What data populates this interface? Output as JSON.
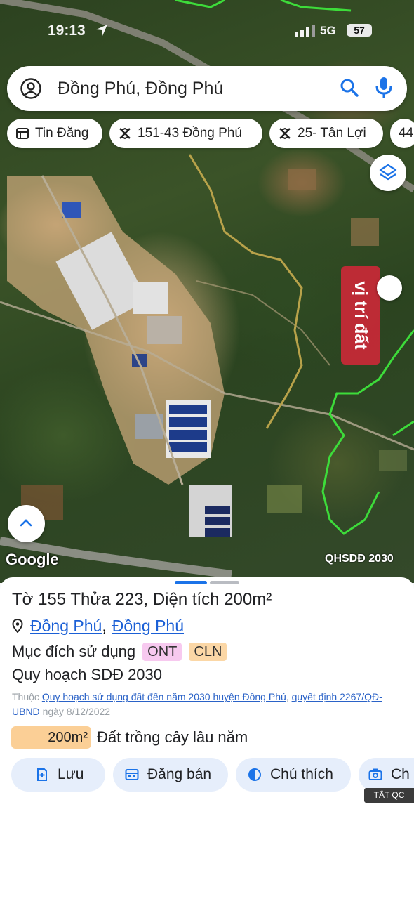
{
  "status_bar": {
    "time": "19:13",
    "network": "5G",
    "battery": "57"
  },
  "search": {
    "query": "Đồng Phú, Đồng Phú"
  },
  "chips": [
    {
      "label": "Tin Đăng",
      "icon": "list-icon"
    },
    {
      "label": "151-43 Đồng Phú",
      "icon": "map-off-icon"
    },
    {
      "label": "25-  Tân Lợi",
      "icon": "map-off-icon"
    },
    {
      "label": "44",
      "icon": "map-off-icon"
    }
  ],
  "map": {
    "pin_label": "vị trí đất",
    "attribution": "Google",
    "layer_label": "QHSDĐ 2030"
  },
  "parcel": {
    "title": "Tờ 155 Thửa 223, Diện tích 200m²",
    "location_part1": "Đồng Phú",
    "location_separator": ",",
    "location_part2": "Đồng Phú",
    "purpose_label": "Mục đích sử dụng",
    "purpose_codes": [
      "ONT",
      "CLN"
    ],
    "plan_title": "Quy hoạch SDĐ 2030",
    "plan_note_prefix": "Thuộc",
    "plan_note_link1": "Quy hoạch sử dụng đất đến năm 2030 huyện Đồng Phú",
    "plan_note_link2": "quyết định 2267/QĐ-UBND",
    "plan_note_suffix": "ngày 8/12/2022",
    "area_value": "200m²",
    "area_desc": "Đất trồng cây lâu năm"
  },
  "actions": [
    {
      "label": "Lưu",
      "icon": "save-icon"
    },
    {
      "label": "Đăng bán",
      "icon": "post-icon"
    },
    {
      "label": "Chú thích",
      "icon": "contrast-icon"
    },
    {
      "label": "Ch",
      "icon": "camera-icon"
    }
  ],
  "ad_badge": "TẮT QC",
  "colors": {
    "accent": "#1b73e8",
    "pin": "#cd2837",
    "plan_border": "#3ddc3a"
  }
}
